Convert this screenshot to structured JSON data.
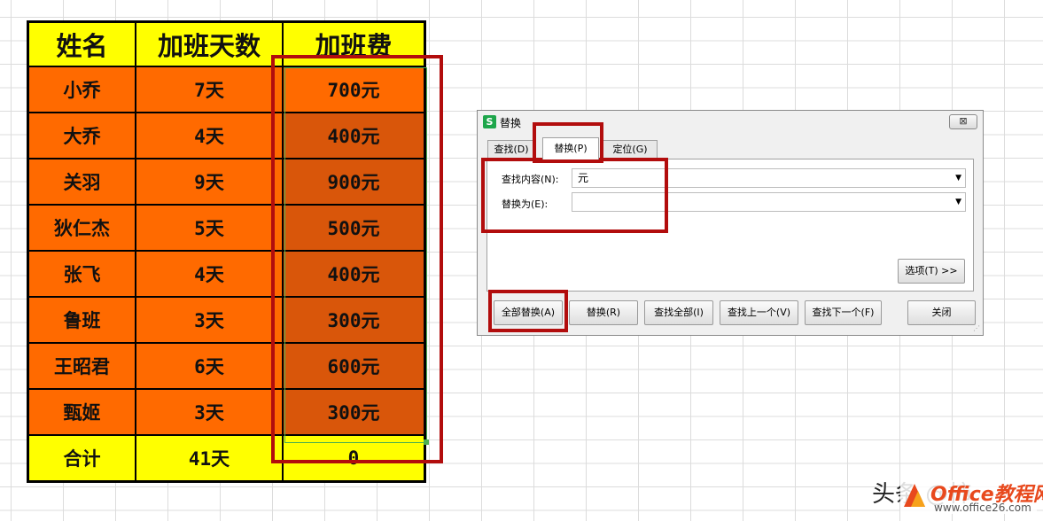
{
  "sheet": {
    "headers": [
      "姓名",
      "加班天数",
      "加班费"
    ],
    "rows": [
      [
        "小乔",
        "7天",
        "700元"
      ],
      [
        "大乔",
        "4天",
        "400元"
      ],
      [
        "关羽",
        "9天",
        "900元"
      ],
      [
        "狄仁杰",
        "5天",
        "500元"
      ],
      [
        "张飞",
        "4天",
        "400元"
      ],
      [
        "鲁班",
        "3天",
        "300元"
      ],
      [
        "王昭君",
        "6天",
        "600元"
      ],
      [
        "甄姬",
        "3天",
        "300元"
      ]
    ],
    "total": [
      "合计",
      "41天",
      "0"
    ]
  },
  "dialog": {
    "title": "替换",
    "app_icon_letter": "S",
    "close_label": "⊠",
    "tabs": [
      "查找(D)",
      "替换(P)",
      "定位(G)"
    ],
    "find_label": "查找内容(N):",
    "find_value": "元",
    "replace_label": "替换为(E):",
    "replace_value": "",
    "options_button": "选项(T) >>",
    "buttons": [
      "全部替换(A)",
      "替换(R)",
      "查找全部(I)",
      "查找上一个(V)",
      "查找下一个(F)",
      "关闭"
    ]
  },
  "watermark": {
    "prefix": "头条 @柿",
    "brand": "Office教程网",
    "site": "www.office26.com"
  },
  "colors": {
    "header_fill": "#ffff00",
    "row_fill": "#ff6a00",
    "selected_fill": "#d9560a",
    "highlight_red": "#b20d0d",
    "selection_green": "#4caf50"
  }
}
